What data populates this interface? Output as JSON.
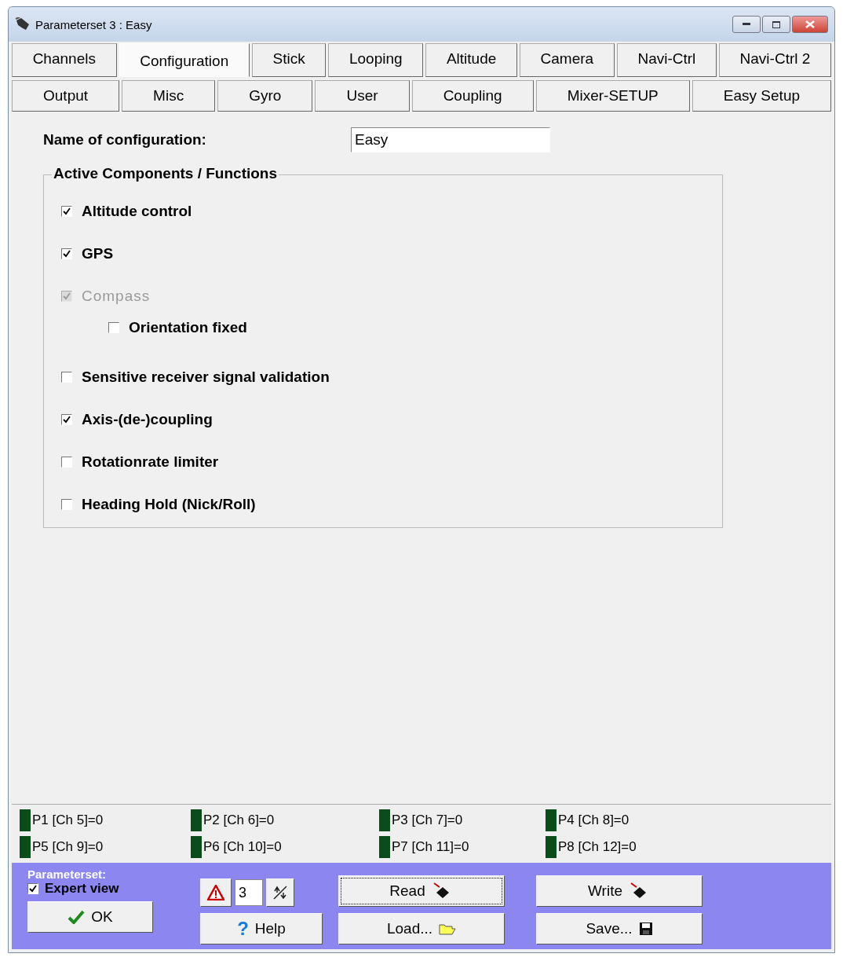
{
  "window": {
    "title": "Parameterset 3 : Easy"
  },
  "tabs": [
    [
      {
        "label": "Channels",
        "selected": false
      },
      {
        "label": "Configuration",
        "selected": true
      },
      {
        "label": "Stick",
        "selected": false
      },
      {
        "label": "Looping",
        "selected": false
      },
      {
        "label": "Altitude",
        "selected": false
      },
      {
        "label": "Camera",
        "selected": false
      },
      {
        "label": "Navi-Ctrl",
        "selected": false
      },
      {
        "label": "Navi-Ctrl 2",
        "selected": false
      }
    ],
    [
      {
        "label": "Output",
        "selected": false
      },
      {
        "label": "Misc",
        "selected": false
      },
      {
        "label": "Gyro",
        "selected": false
      },
      {
        "label": "User",
        "selected": false
      },
      {
        "label": "Coupling",
        "selected": false
      },
      {
        "label": "Mixer-SETUP",
        "selected": false
      },
      {
        "label": "Easy Setup",
        "selected": false
      }
    ]
  ],
  "name_field": {
    "label": "Name of configuration:",
    "value": "Easy"
  },
  "group": {
    "title": "Active Components / Functions",
    "options": [
      {
        "label": "Altitude control",
        "checked": true,
        "disabled": false
      },
      {
        "label": "GPS",
        "checked": true,
        "disabled": false
      },
      {
        "label": "Compass",
        "checked": true,
        "disabled": true,
        "children": [
          {
            "label": "Orientation fixed",
            "checked": false,
            "disabled": false
          }
        ]
      },
      {
        "label": "Sensitive receiver signal validation",
        "checked": false,
        "disabled": false
      },
      {
        "label": "Axis-(de-)coupling",
        "checked": true,
        "disabled": false
      },
      {
        "label": "Rotationrate limiter",
        "checked": false,
        "disabled": false
      },
      {
        "label": "Heading Hold (Nick/Roll)",
        "checked": false,
        "disabled": false
      }
    ]
  },
  "channels": [
    "P1 [Ch 5]=0",
    "P2 [Ch 6]=0",
    "P3 [Ch 7]=0",
    "P4 [Ch 8]=0",
    "P5 [Ch 9]=0",
    "P6 [Ch 10]=0",
    "P7 [Ch 11]=0",
    "P8 [Ch 12]=0"
  ],
  "footer": {
    "title": "Parameterset:",
    "expert_view": {
      "label": "Expert view",
      "checked": true
    },
    "set_number": "3",
    "buttons": [
      {
        "kind": "read",
        "label": "Read"
      },
      {
        "kind": "write",
        "label": "Write"
      },
      {
        "kind": "ok",
        "label": "OK"
      },
      {
        "kind": "help",
        "label": "Help",
        "icon": "?"
      },
      {
        "kind": "load",
        "label": "Load..."
      },
      {
        "kind": "save",
        "label": "Save..."
      }
    ]
  }
}
